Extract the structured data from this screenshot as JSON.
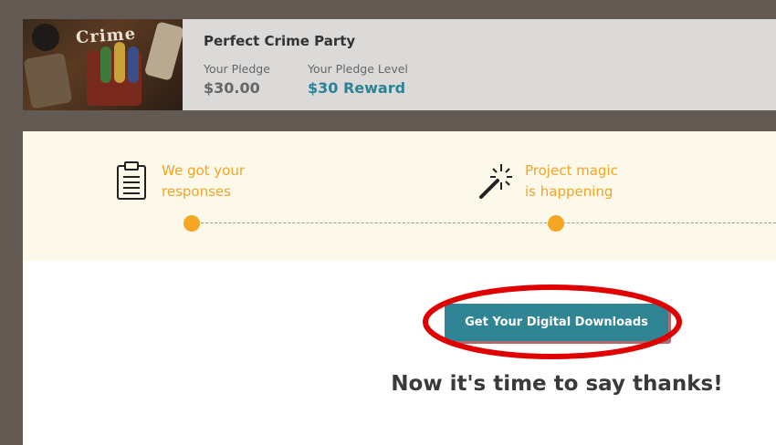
{
  "project": {
    "title": "Perfect Crime Party",
    "thumbnail_logo": "Crime",
    "pledge_label": "Your Pledge",
    "pledge_amount": "$30.00",
    "pledge_level_label": "Your Pledge Level",
    "pledge_level": "$30 Reward"
  },
  "status": {
    "steps": [
      {
        "icon": "clipboard-icon",
        "line1": "We got your",
        "line2": "responses"
      },
      {
        "icon": "magic-wand-icon",
        "line1": "Project magic",
        "line2": "is happening"
      }
    ]
  },
  "main": {
    "download_button": "Get Your Digital Downloads",
    "thanks_heading": "Now it's time to say thanks!"
  },
  "colors": {
    "accent_teal": "#2f8593",
    "reward_teal": "#2a8394",
    "step_orange": "#f0a428",
    "dot_orange": "#f5a623",
    "annotation_red": "#e00000",
    "background_frame": "#635a54"
  }
}
